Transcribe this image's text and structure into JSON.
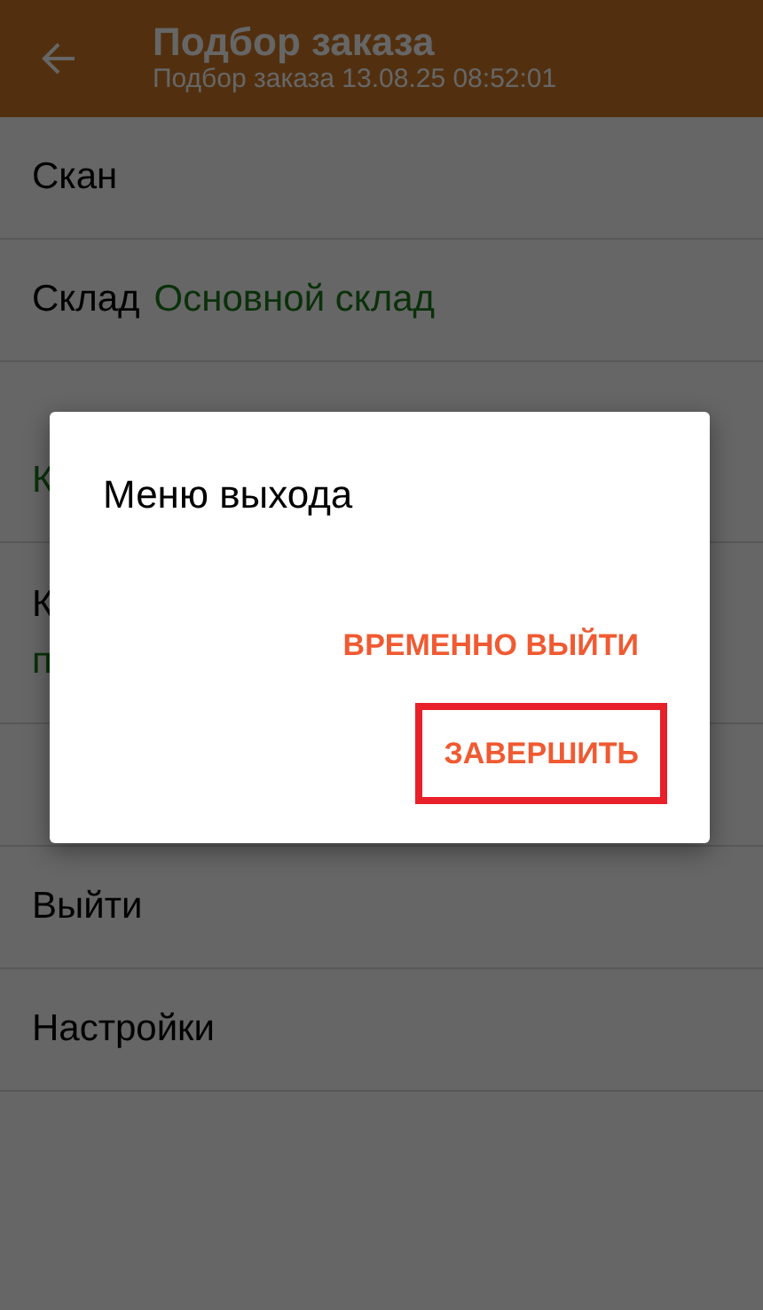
{
  "header": {
    "title": "Подбор заказа",
    "subtitle": "Подбор заказа 13.08.25 08:52:01"
  },
  "menu": [
    {
      "label": "Скан"
    },
    {
      "label": "Склад",
      "value": "Основной склад",
      "kind": "inline"
    },
    {
      "value": "К",
      "kind": "stacked"
    },
    {
      "label": "К",
      "value": "п",
      "kind": "stacked"
    },
    {
      "kind": "covered"
    },
    {
      "label": "Выйти"
    },
    {
      "label": "Настройки"
    }
  ],
  "dialog": {
    "title": "Меню выхода",
    "buttons": [
      {
        "label": "ВРЕМЕННО ВЫЙТИ",
        "highlighted": false
      },
      {
        "label": "ЗАВЕРШИТЬ",
        "highlighted": true
      }
    ]
  }
}
